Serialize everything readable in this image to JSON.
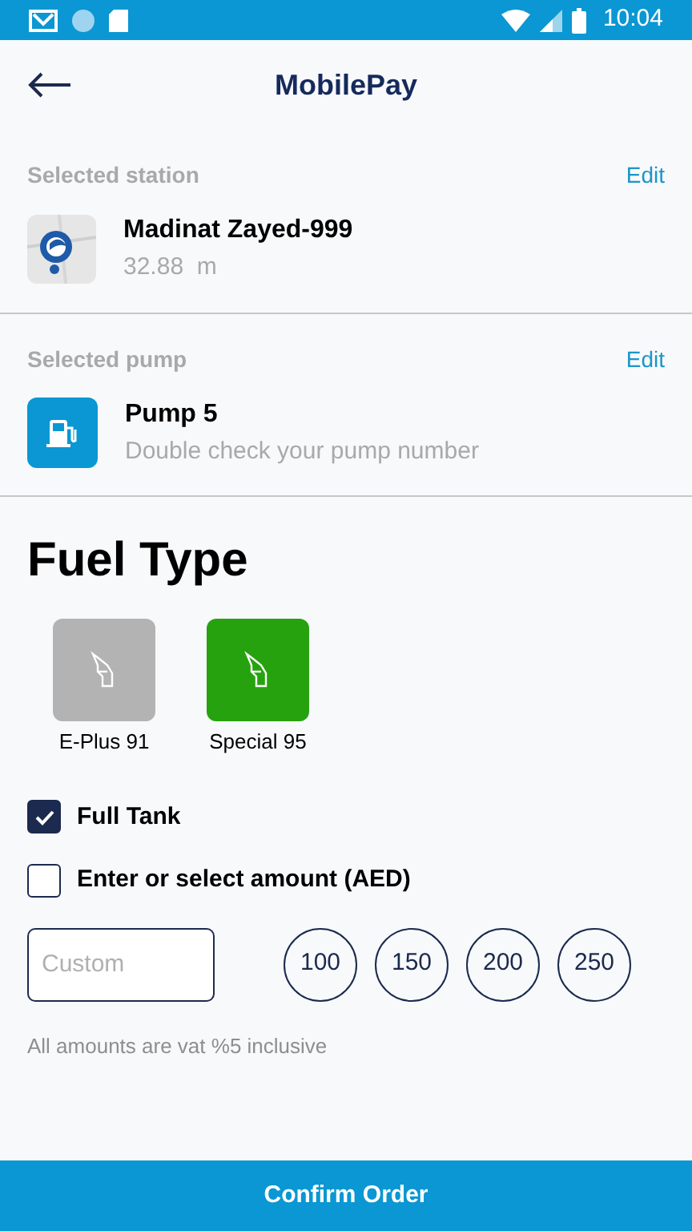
{
  "status_bar": {
    "time": "10:04"
  },
  "header": {
    "title": "MobilePay"
  },
  "station": {
    "label": "Selected station",
    "edit": "Edit",
    "name": "Madinat Zayed-999",
    "distance": "32.88  m"
  },
  "pump": {
    "label": "Selected pump",
    "edit": "Edit",
    "name": "Pump 5",
    "hint": "Double check your pump number"
  },
  "fuel": {
    "title": "Fuel Type",
    "types": [
      {
        "label": "E-Plus 91",
        "selected": false
      },
      {
        "label": "Special 95",
        "selected": true
      }
    ]
  },
  "options": [
    {
      "label": "Full Tank",
      "checked": true
    },
    {
      "label": "Enter or select amount (AED)",
      "checked": false
    }
  ],
  "custom": {
    "placeholder": "Custom"
  },
  "amounts": [
    "100",
    "150",
    "200",
    "250"
  ],
  "note": "All amounts are vat %5 inclusive",
  "confirm": "Confirm Order"
}
